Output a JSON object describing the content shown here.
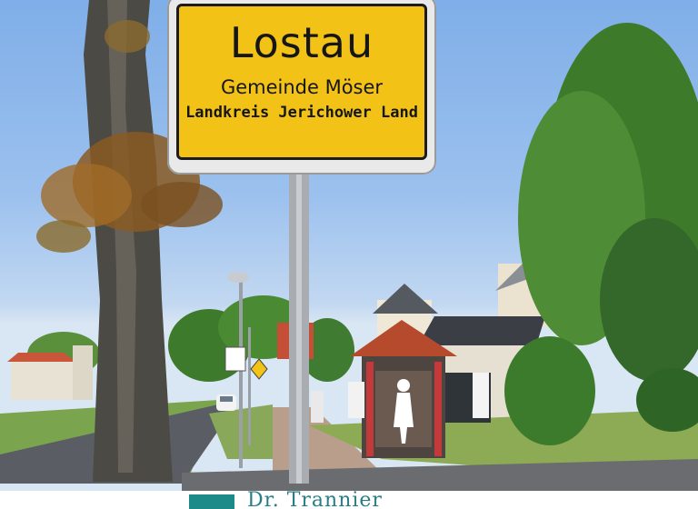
{
  "sign": {
    "town": "Lostau",
    "municipality": "Gemeinde Möser",
    "district": "Landkreis Jerichower Land"
  },
  "footer": {
    "text": "Dr. Trannier"
  },
  "colors": {
    "sign_yellow": "#f2c316",
    "sky": "#8fb7ec",
    "footer_text": "#2a7d86"
  }
}
